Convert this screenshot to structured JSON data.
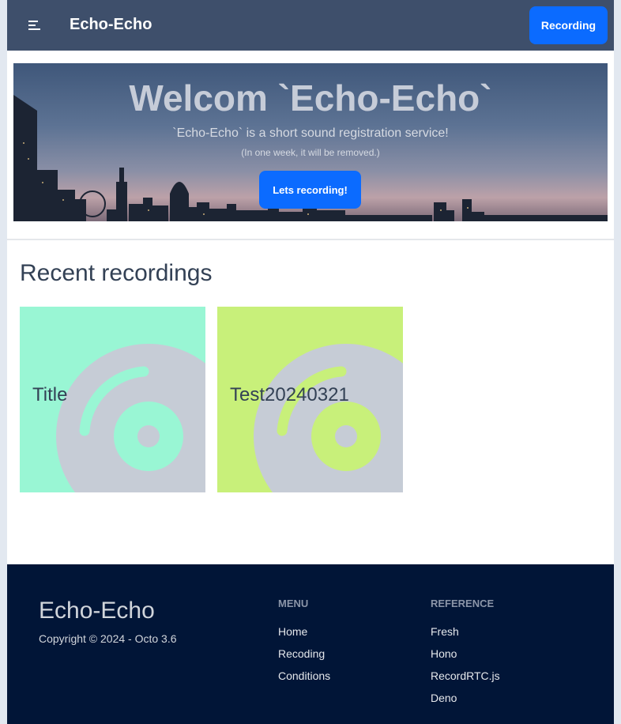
{
  "header": {
    "title": "Echo-Echo",
    "recording_label": "Recording"
  },
  "hero": {
    "title": "Welcom `Echo-Echo`",
    "subtitle": "`Echo-Echo` is a short sound registration service!",
    "note": "(In one week, it will be removed.)",
    "button_label": "Lets recording!"
  },
  "recent": {
    "heading": "Recent recordings",
    "cards": [
      {
        "title": "Title",
        "bg_color": "#99f6d4",
        "accent_color": "#99f6d4"
      },
      {
        "title": "Test20240321",
        "bg_color": "#c8f07a",
        "accent_color": "#c8f07a"
      }
    ]
  },
  "footer": {
    "brand": "Echo-Echo",
    "copyright": "Copyright © 2024 - Octo 3.6",
    "menu": {
      "heading": "MENU",
      "links": [
        "Home",
        "Recoding",
        "Conditions"
      ]
    },
    "reference": {
      "heading": "REFERENCE",
      "links": [
        "Fresh",
        "Hono",
        "RecordRTC.js",
        "Deno"
      ]
    }
  },
  "colors": {
    "header_bg": "#3e4f6b",
    "accent": "#0b6bff",
    "footer_bg": "#011537"
  }
}
